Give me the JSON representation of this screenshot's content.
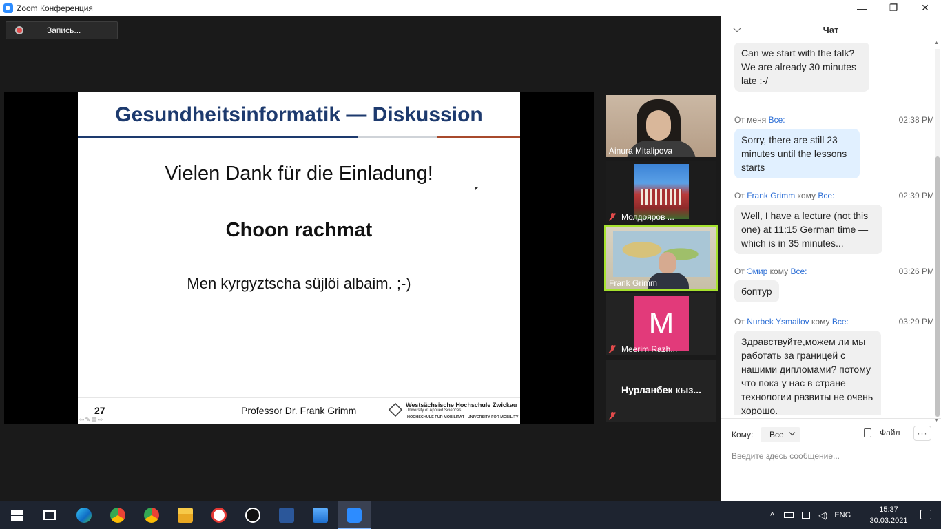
{
  "window": {
    "title": "Zoom Конференция",
    "minimize": "—",
    "maximize": "❐",
    "close": "✕"
  },
  "recording": {
    "label": "Запись..."
  },
  "slide": {
    "title": "Gesundheitsinformatik — Diskussion",
    "line1": "Vielen Dank für die Einladung!",
    "line2": "Choon rachmat",
    "line3": "Men kyrgyztscha süjlöi albaim. ;-)",
    "page": "27",
    "presenter": "Professor Dr. Frank Grimm",
    "uni_line1": "Westsächsische Hochschule Zwickau",
    "uni_line2": "University of Applied Sciences",
    "uni_line3": "HOCHSCHULE FÜR MOBILITÄT | UNIVERSITY FOR MOBILITY"
  },
  "participants": [
    {
      "name": "Ainura Mitalipova"
    },
    {
      "name": "Молдояров ..."
    },
    {
      "name": "Frank Grimm"
    },
    {
      "name": "Meerim Razh...",
      "initial": "M"
    },
    {
      "name": "Нурланбек  кыз..."
    }
  ],
  "chat": {
    "title": "Чат",
    "messages": [
      {
        "text": "Can we start with the talk? We are already 30 minutes late :-/"
      },
      {
        "from": "От меня",
        "to": "Все:",
        "time": "02:38 PM",
        "text": "Sorry, there are still 23 minutes until the lessons starts"
      },
      {
        "from": "От",
        "sender": "Frank Grimm",
        "to_word": "кому",
        "to": "Все:",
        "time": "02:39 PM",
        "text": "Well, I have a lecture (not this one) at 11:15 German time — which is in 35 minutes..."
      },
      {
        "from": "От",
        "sender": "Эмир",
        "to_word": "кому",
        "to": "Все:",
        "time": "03:26 PM",
        "text": "боптур"
      },
      {
        "from": "От",
        "sender": "Nurbek Ysmailov",
        "to_word": "кому",
        "to": "Все:",
        "time": "03:29 PM",
        "text": "Здравствуйте,можем ли мы работать за границей с нашими дипломами? потому что пока у нас в стране технологии развиты не очень хорошо."
      }
    ],
    "to_label": "Кому:",
    "to_value": "Все",
    "file_label": "Файл",
    "more_label": "···",
    "input_placeholder": "Введите здесь сообщение..."
  },
  "taskbar": {
    "apps": [
      "start-icon",
      "task-view-icon",
      "edge-icon",
      "chrome-icon",
      "chrome-profile-icon",
      "file-explorer-icon",
      "yandex-icon",
      "inkscape-icon",
      "word-icon",
      "photos-icon",
      "zoom-icon"
    ],
    "tray_chevron": "^",
    "language": "ENG",
    "time": "15:37",
    "date": "30.03.2021"
  },
  "colors": {
    "slide_title": "#1d3a6e",
    "chat_blue": "#2d6fd6",
    "active_speaker": "#a6e22e",
    "zoom_blue": "#2d8cff"
  }
}
